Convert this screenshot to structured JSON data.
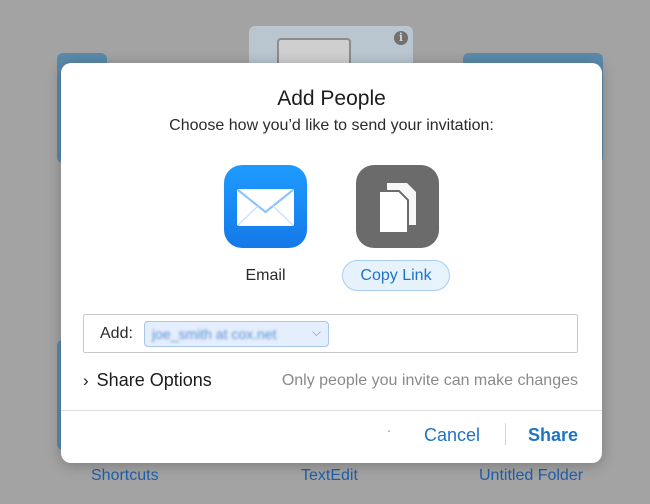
{
  "background": {
    "labels": [
      "Shortcuts",
      "TextEdit",
      "Untitled Folder"
    ]
  },
  "dialog": {
    "title": "Add People",
    "subtitle": "Choose how you’d like to send your invitation:",
    "options": [
      {
        "label": "Email",
        "icon": "mail-envelope-icon"
      },
      {
        "label": "Copy Link",
        "icon": "copy-documents-icon"
      }
    ],
    "add": {
      "label": "Add:",
      "recipient": "joe_smith at cox.net"
    },
    "share_options": {
      "label": "Share Options",
      "hint": "Only people you invite can make changes"
    },
    "footer": {
      "dot": ".",
      "cancel": "Cancel",
      "share": "Share"
    }
  },
  "colors": {
    "accent": "#1e73c8",
    "email_tile": "#1e9bff",
    "copy_tile": "#6b6b6b",
    "backdrop": "#a3a3a3"
  }
}
